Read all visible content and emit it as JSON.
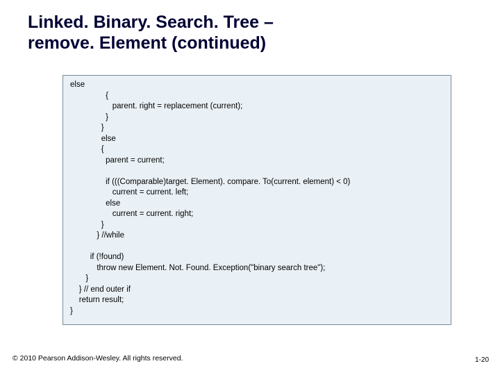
{
  "title_line1": "Linked. Binary. Search. Tree –",
  "title_line2": "remove. Element (continued)",
  "code": "else\n                {\n                   parent. right = replacement (current);\n                }\n              }\n              else\n              {\n                parent = current;\n\n                if (((Comparable)target. Element). compare. To(current. element) < 0)\n                   current = current. left;\n                else\n                   current = current. right;\n              }\n            } //while\n\n         if (!found)\n            throw new Element. Not. Found. Exception(\"binary search tree\");\n       }\n    } // end outer if\n    return result;\n}",
  "footer_left": "© 2010 Pearson Addison-Wesley. All rights reserved.",
  "footer_right": "1-20"
}
